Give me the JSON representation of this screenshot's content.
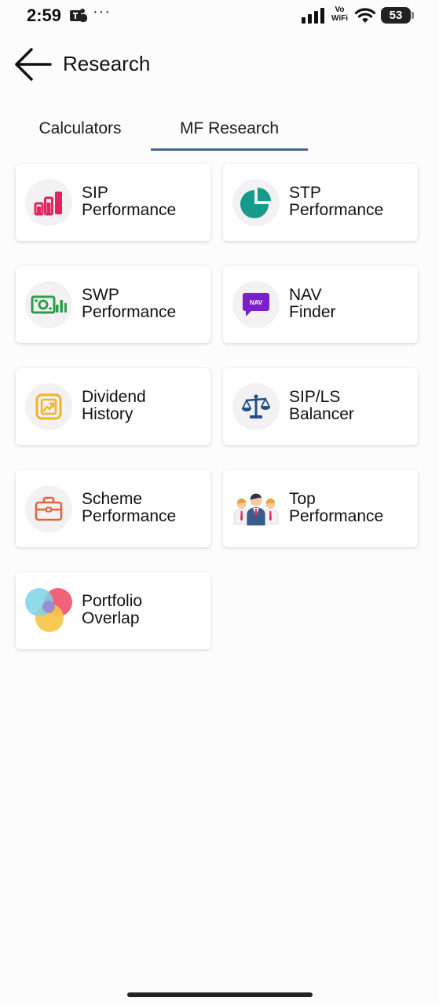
{
  "status_bar": {
    "time": "2:59",
    "more": "···",
    "vo": "Vo",
    "wifi_text": "WiFi",
    "battery": "53"
  },
  "header": {
    "title": "Research"
  },
  "tabs": [
    {
      "label": "Calculators",
      "selected": false
    },
    {
      "label": "MF Research",
      "selected": true
    }
  ],
  "cards": [
    {
      "line1": "SIP",
      "line2": "Performance",
      "icon": "bar-chart-icon"
    },
    {
      "line1": "STP",
      "line2": "Performance",
      "icon": "pie-chart-icon"
    },
    {
      "line1": "SWP",
      "line2": "Performance",
      "icon": "money-chart-icon"
    },
    {
      "line1": "NAV",
      "line2": "Finder",
      "icon": "nav-chat-icon",
      "badge": "NAV"
    },
    {
      "line1": "Dividend",
      "line2": "History",
      "icon": "trend-frame-icon"
    },
    {
      "line1": "SIP/LS",
      "line2": "Balancer",
      "icon": "scale-icon"
    },
    {
      "line1": "Scheme",
      "line2": "Performance",
      "icon": "briefcase-icon"
    },
    {
      "line1": "Top",
      "line2": "Performance",
      "icon": "team-icon"
    },
    {
      "line1": "Portfolio",
      "line2": "Overlap",
      "icon": "venn-icon"
    }
  ],
  "colors": {
    "tab_underline": "#4a6591",
    "sip_icon": "#e0245e",
    "stp_icon": "#169a8a",
    "swp_icon": "#2e9e4a",
    "nav_icon": "#7a1fc9",
    "dividend_icon": "#f2b320",
    "balancer_icon": "#1f4f8a",
    "scheme_icon": "#e2643c"
  }
}
